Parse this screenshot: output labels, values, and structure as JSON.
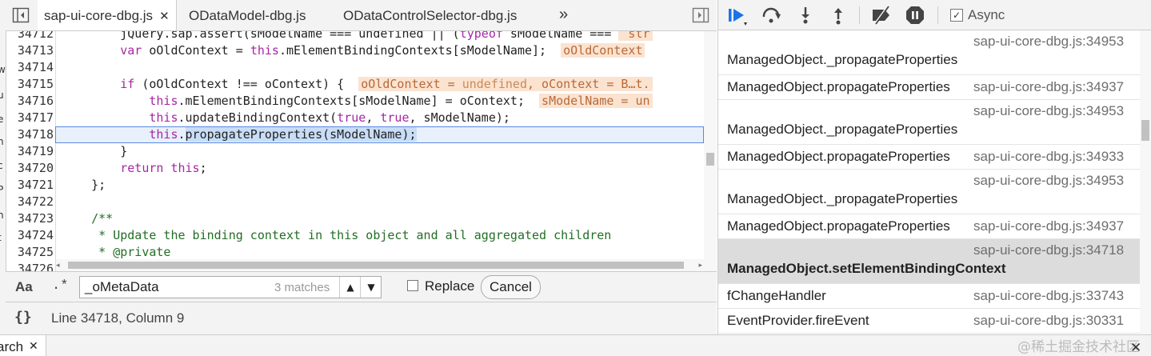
{
  "left_clip_chars": [
    "w",
    "u",
    "e",
    "h",
    "c",
    "P",
    "n",
    "t"
  ],
  "editor": {
    "tabs": [
      {
        "label": "sap-ui-core-dbg.js"
      },
      {
        "label": "ODataModel-dbg.js"
      },
      {
        "label": "ODataControlSelector-dbg.js"
      }
    ],
    "more_tabs": "»",
    "lines": [
      {
        "num": "34712"
      },
      {
        "num": "34713"
      },
      {
        "num": "34714"
      },
      {
        "num": "34715"
      },
      {
        "num": "34716"
      },
      {
        "num": "34717"
      },
      {
        "num": "34718"
      },
      {
        "num": "34719"
      },
      {
        "num": "34720"
      },
      {
        "num": "34721"
      },
      {
        "num": "34722"
      },
      {
        "num": "34723"
      },
      {
        "num": "34724"
      },
      {
        "num": "34725"
      },
      {
        "num": "34726"
      }
    ],
    "code": {
      "l1a": "        jQuery.sap.assert(sModelName === undefined || (",
      "l1kw": "typeof",
      "l1b": " sModelName === ",
      "l1c": " str",
      "l2kw": "        var",
      "l2a": " oOldContext = ",
      "l2this": "this",
      "l2b": ".mElementBindingContexts[sModelName];",
      "l2inl": "oOldContext",
      "l4kw": "        if",
      "l4a": " (oOldContext !== oContext) {",
      "l4inl_a": "oOldContext = ",
      "l4inl_u": "undefined",
      "l4inl_b": ", oContext = B…t.",
      "l5this": "            this",
      "l5a": ".mElementBindingContexts[sModelName] = oContext;",
      "l5inl": "sModelName = un",
      "l6this": "            this",
      "l6a": ".updateBindingContext(",
      "l6t1": "true",
      "l6b": ", ",
      "l6t2": "true",
      "l6c": ", sModelName);",
      "l7this": "            this",
      "l7dot": ".",
      "l7sel": "propagateProperties(sModelName);",
      "l8": "        }",
      "l9kw": "        return",
      "l9a": " ",
      "l9this": "this",
      "l9b": ";",
      "l10": "    };",
      "l12": "    /**",
      "l13": "     * Update the binding context in this object and all aggregated children",
      "l14": "     * @private"
    },
    "find": {
      "case_label": "Aa",
      "regex_label": ".*",
      "query": "_oMetaData",
      "matches": "3 matches",
      "replace_label": "Replace",
      "cancel_label": "Cancel"
    },
    "status": {
      "pretty": "{}",
      "position": "Line 34718, Column 9"
    }
  },
  "debugger": {
    "async_label": "Async",
    "frames": [
      {
        "name": "ManagedObject._propagateProperties",
        "loc": "sap-ui-core-dbg.js:34953",
        "stacked": true
      },
      {
        "name": "ManagedObject.propagateProperties",
        "loc": "sap-ui-core-dbg.js:34937",
        "stacked": false
      },
      {
        "name": "ManagedObject._propagateProperties",
        "loc": "sap-ui-core-dbg.js:34953",
        "stacked": true
      },
      {
        "name": "ManagedObject.propagateProperties",
        "loc": "sap-ui-core-dbg.js:34933",
        "stacked": false
      },
      {
        "name": "ManagedObject._propagateProperties",
        "loc": "sap-ui-core-dbg.js:34953",
        "stacked": true
      },
      {
        "name": "ManagedObject.propagateProperties",
        "loc": "sap-ui-core-dbg.js:34937",
        "stacked": false
      },
      {
        "name": "ManagedObject.setElementBindingContext",
        "loc": "sap-ui-core-dbg.js:34718",
        "stacked": true,
        "selected": true
      },
      {
        "name": "fChangeHandler",
        "loc": "sap-ui-core-dbg.js:33743",
        "stacked": false
      },
      {
        "name": "EventProvider.fireEvent",
        "loc": "sap-ui-core-dbg.js:30331",
        "stacked": false
      }
    ]
  },
  "drawer": {
    "tab_label": "arch",
    "watermark": "@稀土掘金技术社区"
  },
  "colors": {
    "accent": "#1a73e8",
    "keyword": "#a626a4",
    "comment": "#236e25",
    "selection": "#c8ddf7"
  }
}
